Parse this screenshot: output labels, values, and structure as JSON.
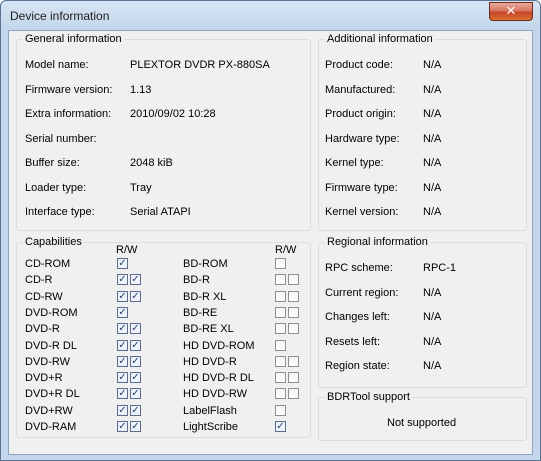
{
  "window": {
    "title": "Device information",
    "close_label": "✕"
  },
  "general": {
    "title": "General information",
    "rows": [
      {
        "label": "Model name:",
        "value": "PLEXTOR  DVDR   PX-880SA"
      },
      {
        "label": "Firmware version:",
        "value": "1.13"
      },
      {
        "label": "Extra information:",
        "value": "2010/09/02 10:28"
      },
      {
        "label": "Serial number:",
        "value": ""
      },
      {
        "label": "Buffer size:",
        "value": "2048 kiB"
      },
      {
        "label": "Loader type:",
        "value": "Tray"
      },
      {
        "label": "Interface type:",
        "value": "Serial ATAPI"
      }
    ]
  },
  "additional": {
    "title": "Additional information",
    "rows": [
      {
        "label": "Product code:",
        "value": "N/A"
      },
      {
        "label": "Manufactured:",
        "value": "N/A"
      },
      {
        "label": "Product origin:",
        "value": "N/A"
      },
      {
        "label": "Hardware type:",
        "value": "N/A"
      },
      {
        "label": "Kernel type:",
        "value": "N/A"
      },
      {
        "label": "Firmware type:",
        "value": "N/A"
      },
      {
        "label": "Kernel version:",
        "value": "N/A"
      }
    ]
  },
  "capabilities": {
    "title": "Capabilities",
    "rw_header": "R/W",
    "left": [
      {
        "label": "CD-ROM",
        "r": true,
        "w": null
      },
      {
        "label": "CD-R",
        "r": true,
        "w": true
      },
      {
        "label": "CD-RW",
        "r": true,
        "w": true
      },
      {
        "label": "DVD-ROM",
        "r": true,
        "w": null
      },
      {
        "label": "DVD-R",
        "r": true,
        "w": true
      },
      {
        "label": "DVD-R DL",
        "r": true,
        "w": true
      },
      {
        "label": "DVD-RW",
        "r": true,
        "w": true
      },
      {
        "label": "DVD+R",
        "r": true,
        "w": true
      },
      {
        "label": "DVD+R DL",
        "r": true,
        "w": true
      },
      {
        "label": "DVD+RW",
        "r": true,
        "w": true
      },
      {
        "label": "DVD-RAM",
        "r": true,
        "w": true
      }
    ],
    "right": [
      {
        "label": "BD-ROM",
        "r": false,
        "w": null
      },
      {
        "label": "BD-R",
        "r": false,
        "w": false
      },
      {
        "label": "BD-R XL",
        "r": false,
        "w": false
      },
      {
        "label": "BD-RE",
        "r": false,
        "w": false
      },
      {
        "label": "BD-RE XL",
        "r": false,
        "w": false
      },
      {
        "label": "HD DVD-ROM",
        "r": false,
        "w": null
      },
      {
        "label": "HD DVD-R",
        "r": false,
        "w": false
      },
      {
        "label": "HD DVD-R DL",
        "r": false,
        "w": false
      },
      {
        "label": "HD DVD-RW",
        "r": false,
        "w": false
      },
      {
        "label": "LabelFlash",
        "r": false,
        "w": null
      },
      {
        "label": "LightScribe",
        "r": true,
        "w": null
      }
    ]
  },
  "regional": {
    "title": "Regional information",
    "rows": [
      {
        "label": "RPC scheme:",
        "value": "RPC-1"
      },
      {
        "label": "Current region:",
        "value": "N/A"
      },
      {
        "label": "Changes left:",
        "value": "N/A"
      },
      {
        "label": "Resets left:",
        "value": "N/A"
      },
      {
        "label": "Region state:",
        "value": "N/A"
      }
    ]
  },
  "bdrtool": {
    "title": "BDRTool support",
    "status": "Not supported"
  },
  "colors": {
    "titlebar": "#c4d6ea",
    "close": "#c74529",
    "panel": "#f0f0f0",
    "group_border": "#d5dfe5"
  },
  "icons": {
    "close": "close-icon",
    "checkbox": "checkbox"
  }
}
